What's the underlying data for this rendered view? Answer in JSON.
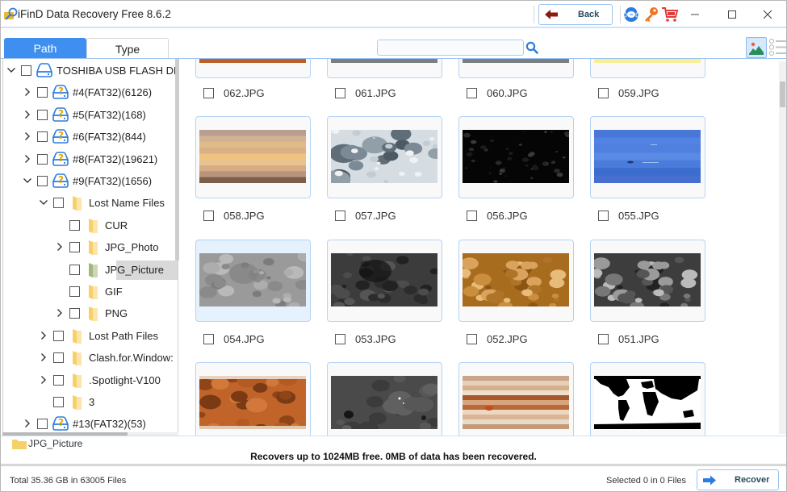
{
  "app": {
    "title": "iFinD Data Recovery Free 8.6.2"
  },
  "toolbar": {
    "back_label": "Back",
    "icons": [
      "support-chat-icon",
      "key-icon",
      "cart-icon"
    ],
    "window_controls": [
      "minimize",
      "maximize",
      "close"
    ]
  },
  "tabs": [
    {
      "label": "Path",
      "active": true
    },
    {
      "label": "Type",
      "active": false
    }
  ],
  "search": {
    "value": "",
    "placeholder": ""
  },
  "view_modes": {
    "thumbnail_active": true,
    "list_active": false
  },
  "tree": [
    {
      "label": "TOSHIBA USB FLASH DRI",
      "level": 0,
      "icon": "usb-drive-icon",
      "expander": "expanded"
    },
    {
      "label": "#4(FAT32)(6126)",
      "level": 1,
      "icon": "lost-partition-icon",
      "expander": "collapsed"
    },
    {
      "label": "#5(FAT32)(168)",
      "level": 1,
      "icon": "lost-partition-icon",
      "expander": "collapsed"
    },
    {
      "label": "#6(FAT32)(844)",
      "level": 1,
      "icon": "lost-partition-icon",
      "expander": "collapsed"
    },
    {
      "label": "#8(FAT32)(19621)",
      "level": 1,
      "icon": "lost-partition-icon",
      "expander": "collapsed"
    },
    {
      "label": "#9(FAT32)(1656)",
      "level": 1,
      "icon": "lost-partition-icon",
      "expander": "expanded"
    },
    {
      "label": "Lost Name Files",
      "level": 2,
      "icon": "folder-icon",
      "expander": "expanded"
    },
    {
      "label": "CUR",
      "level": 3,
      "icon": "folder-icon",
      "expander": "none"
    },
    {
      "label": "JPG_Photo",
      "level": 3,
      "icon": "folder-icon",
      "expander": "collapsed"
    },
    {
      "label": "JPG_Picture",
      "level": 3,
      "icon": "folder-icon",
      "expander": "none",
      "selected": true
    },
    {
      "label": "GIF",
      "level": 3,
      "icon": "folder-icon",
      "expander": "none"
    },
    {
      "label": "PNG",
      "level": 3,
      "icon": "folder-icon",
      "expander": "collapsed"
    },
    {
      "label": "Lost Path Files",
      "level": 2,
      "icon": "folder-icon",
      "expander": "collapsed"
    },
    {
      "label": "Clash.for.Window:",
      "level": 2,
      "icon": "folder-icon",
      "expander": "collapsed"
    },
    {
      "label": ".Spotlight-V100",
      "level": 2,
      "icon": "folder-icon",
      "expander": "collapsed"
    },
    {
      "label": "3",
      "level": 2,
      "icon": "folder-icon",
      "expander": "none"
    },
    {
      "label": "#13(FAT32)(53)",
      "level": 1,
      "icon": "lost-partition-icon",
      "expander": "collapsed"
    }
  ],
  "files": [
    {
      "name": "062.JPG",
      "thumb": "orange-strip",
      "checked": false
    },
    {
      "name": "061.JPG",
      "thumb": "gray-strip",
      "checked": false
    },
    {
      "name": "060.JPG",
      "thumb": "gray-strip",
      "checked": false
    },
    {
      "name": "059.JPG",
      "thumb": "yellow-strip",
      "checked": false
    },
    {
      "name": "058.JPG",
      "thumb": "saturn-bands",
      "checked": false
    },
    {
      "name": "057.JPG",
      "thumb": "icy-moon",
      "checked": false
    },
    {
      "name": "056.JPG",
      "thumb": "dark-speckle",
      "checked": false
    },
    {
      "name": "055.JPG",
      "thumb": "neptune-blue",
      "checked": false
    },
    {
      "name": "054.JPG",
      "thumb": "gray-moon",
      "checked": false,
      "highlighted": true
    },
    {
      "name": "053.JPG",
      "thumb": "dark-moon",
      "checked": false
    },
    {
      "name": "052.JPG",
      "thumb": "venus-gold",
      "checked": false
    },
    {
      "name": "051.JPG",
      "thumb": "venus-gray",
      "checked": false
    },
    {
      "name": "",
      "thumb": "mars",
      "checked": false
    },
    {
      "name": "",
      "thumb": "gray-crater",
      "checked": false
    },
    {
      "name": "",
      "thumb": "jupiter",
      "checked": false
    },
    {
      "name": "",
      "thumb": "world-map",
      "checked": false
    }
  ],
  "path_bar": {
    "current": "JPG_Picture"
  },
  "message": "Recovers up to 1024MB free. 0MB of data has been recovered.",
  "status": {
    "total": "Total 35.36 GB in 63005 Files",
    "selected": "Selected 0 in 0 Files",
    "recover_label": "Recover"
  },
  "colors": {
    "accent": "#3f8ff0",
    "thumb_border": "#b5d3f5",
    "folder": "#f7d067",
    "folder_selected": "#a4b67c",
    "key": "#f0741e",
    "cart": "#e23b3b",
    "back_arrow": "#8b1a0f"
  }
}
